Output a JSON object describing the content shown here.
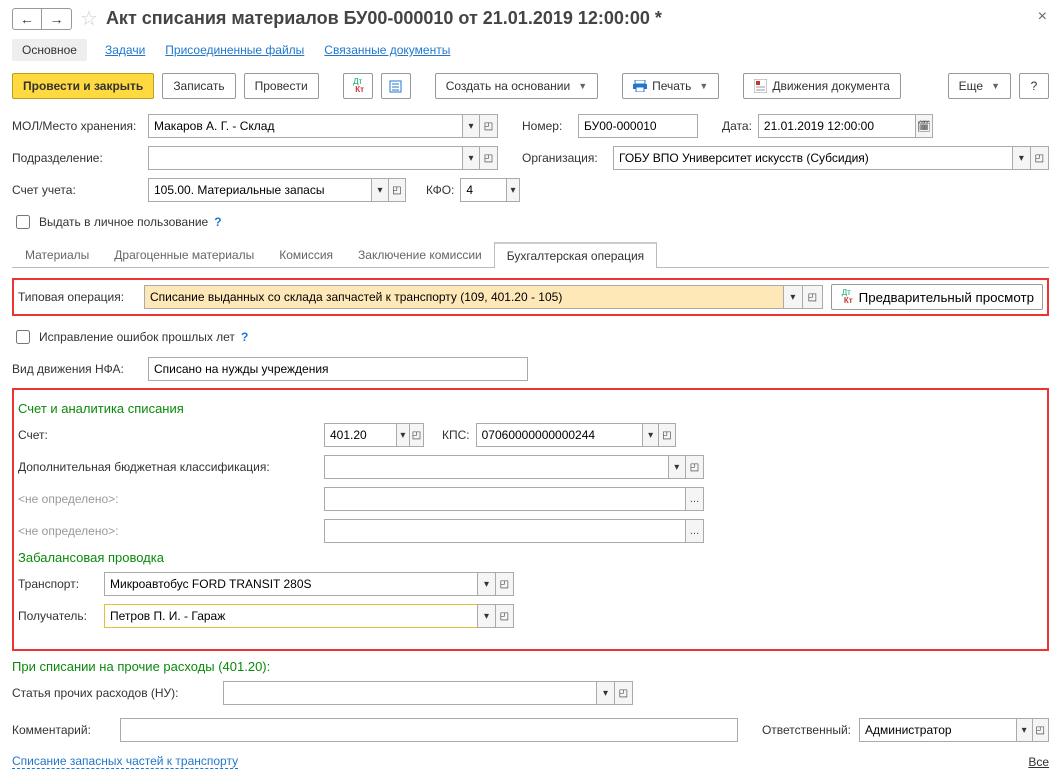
{
  "title": "Акт списания материалов БУ00-000010 от 21.01.2019 12:00:00 *",
  "nav": {
    "main": "Основное",
    "tasks": "Задачи",
    "files": "Присоединенные файлы",
    "linked": "Связанные документы"
  },
  "toolbar": {
    "post_close": "Провести и закрыть",
    "save": "Записать",
    "post": "Провести",
    "create_based": "Создать на основании",
    "print": "Печать",
    "movements": "Движения документа",
    "more": "Еще"
  },
  "fields": {
    "mol_label": "МОЛ/Место хранения:",
    "mol_value": "Макаров А. Г. - Склад",
    "number_label": "Номер:",
    "number_value": "БУ00-000010",
    "date_label": "Дата:",
    "date_value": "21.01.2019 12:00:00",
    "dept_label": "Подразделение:",
    "dept_value": "",
    "org_label": "Организация:",
    "org_value": "ГОБУ ВПО Университет искусств (Субсидия)",
    "account_label": "Счет учета:",
    "account_value": "105.00. Материальные запасы",
    "kfo_label": "КФО:",
    "kfo_value": "4",
    "personal_use": "Выдать в личное пользование"
  },
  "tabs": {
    "t1": "Материалы",
    "t2": "Драгоценные материалы",
    "t3": "Комиссия",
    "t4": "Заключение комиссии",
    "t5": "Бухгалтерская операция"
  },
  "typop": {
    "label": "Типовая операция:",
    "value": "Списание выданных со склада запчастей к транспорту (109, 401.20 - 105)",
    "preview": "Предварительный просмотр",
    "fix_errors": "Исправление ошибок прошлых лет",
    "nfa_label": "Вид движения НФА:",
    "nfa_value": "Списано на нужды учреждения"
  },
  "writeoff": {
    "title": "Счет и аналитика списания",
    "account_label": "Счет:",
    "account_value": "401.20",
    "kps_label": "КПС:",
    "kps_value": "07060000000000244",
    "extra_label": "Дополнительная бюджетная классификация:",
    "extra_value": "",
    "undef": "<не определено>:",
    "offbalance_title": "Забалансовая проводка",
    "transport_label": "Транспорт:",
    "transport_value": "Микроавтобус FORD TRANSIT 280S",
    "recipient_label": "Получатель:",
    "recipient_value": "Петров П. И. - Гараж"
  },
  "other_exp": {
    "title": "При списании на прочие расходы (401.20):",
    "item_label": "Статья прочих расходов (НУ):",
    "item_value": ""
  },
  "footer": {
    "comment_label": "Комментарий:",
    "comment_value": "",
    "responsible_label": "Ответственный:",
    "responsible_value": "Администратор",
    "bottom_link": "Списание запасных частей к транспорту",
    "all": "Все"
  }
}
